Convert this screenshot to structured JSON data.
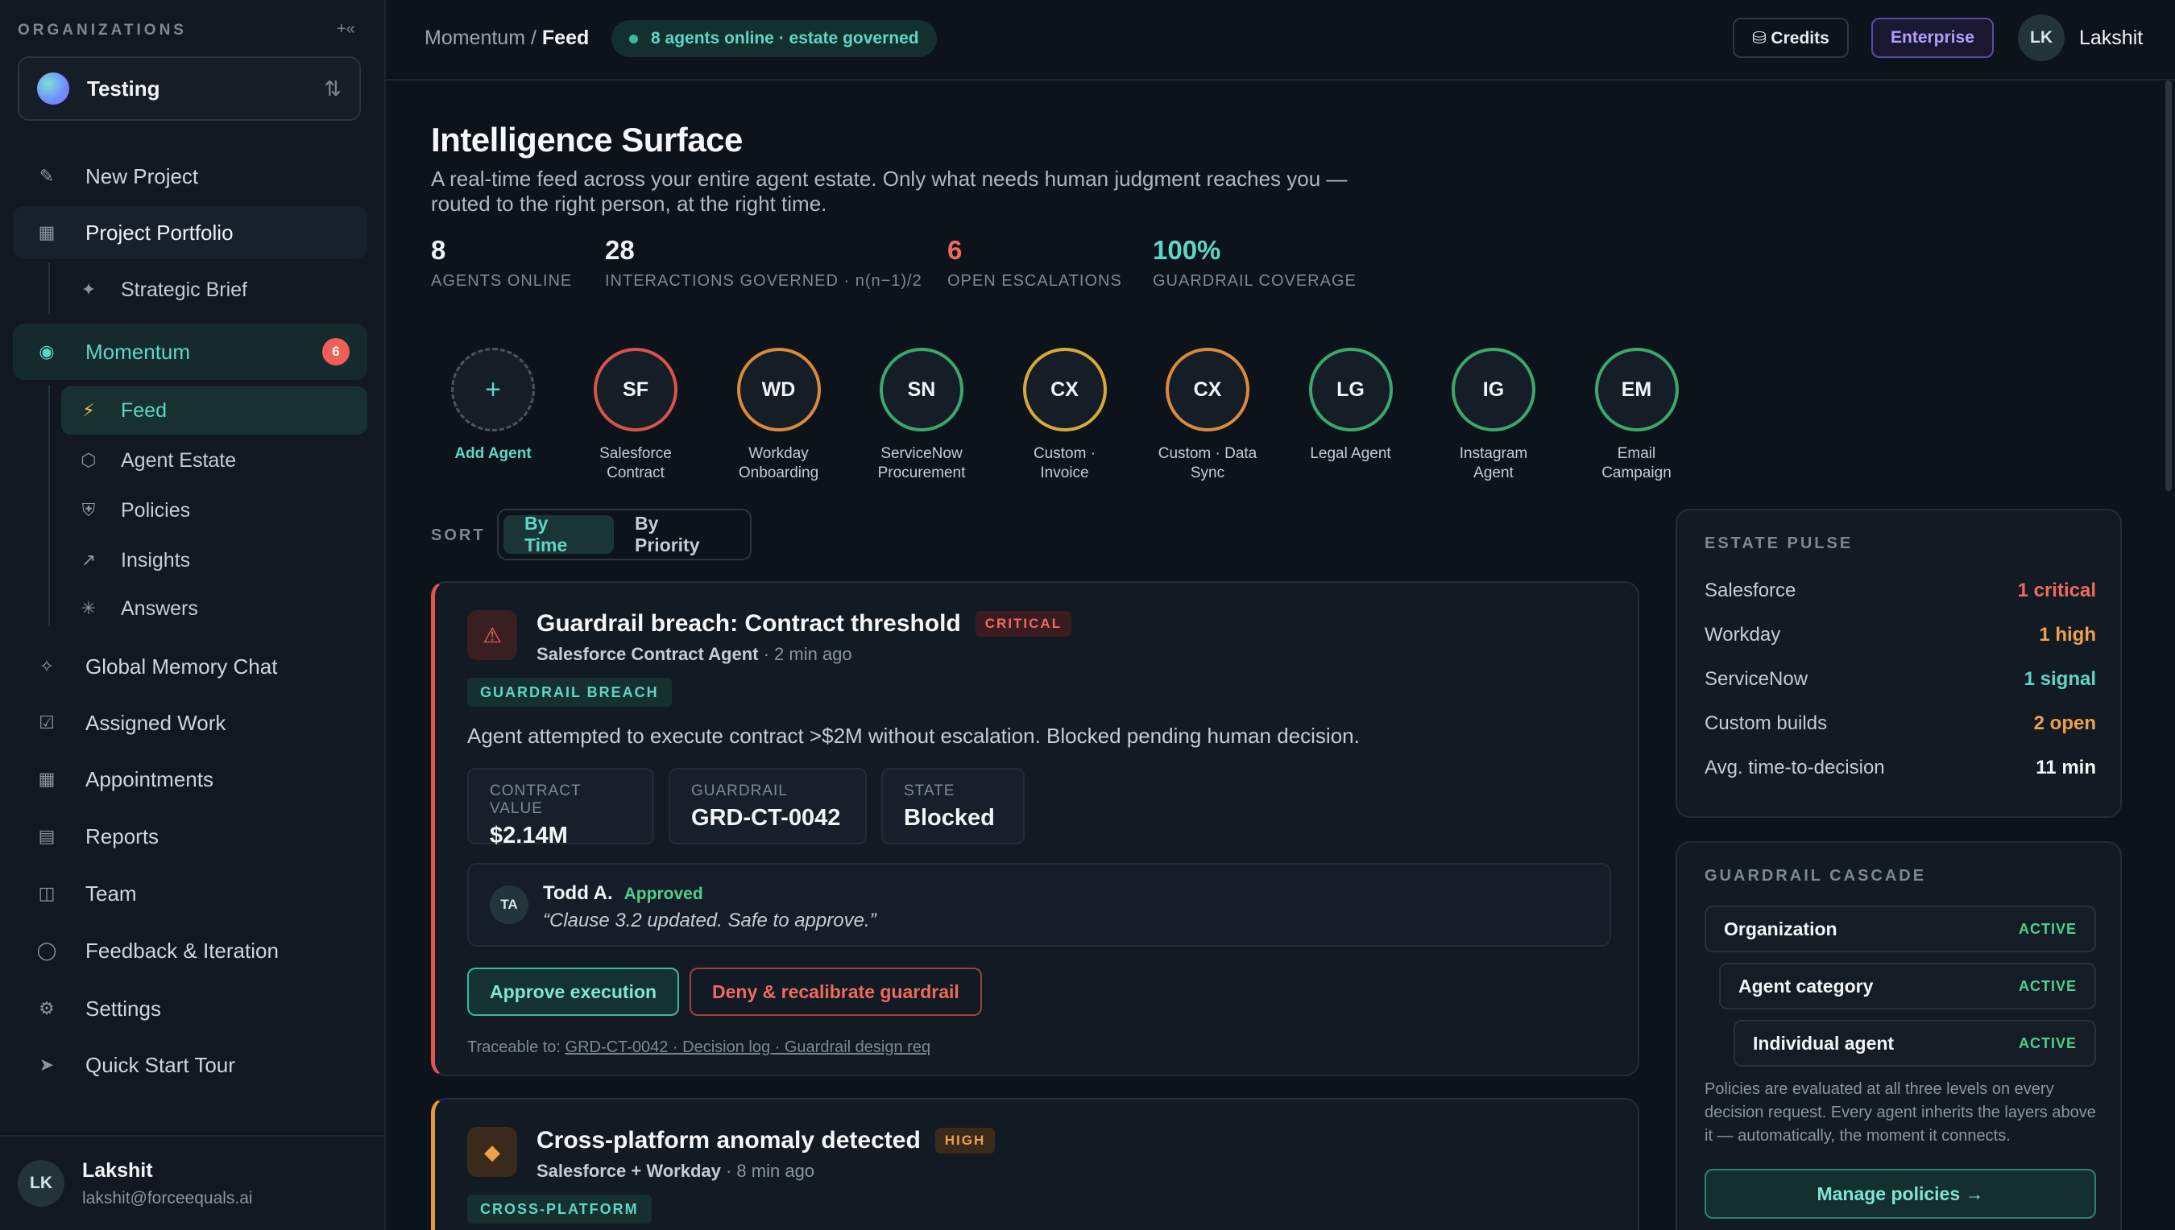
{
  "sidebar": {
    "org_label": "ORGANIZATIONS",
    "collapse_label": "+«",
    "org_name": "Testing",
    "org_switch_icon": "⇅",
    "items": [
      {
        "label": "New Project",
        "icon": "✎"
      },
      {
        "label": "Project Portfolio",
        "icon": "▦"
      },
      {
        "label": "Strategic Brief",
        "icon": "✦"
      },
      {
        "label": "Momentum",
        "icon": "◉",
        "badge": "6"
      },
      {
        "label": "Feed",
        "icon": "⚡"
      },
      {
        "label": "Agent Estate",
        "icon": "⬡"
      },
      {
        "label": "Policies",
        "icon": "⛨"
      },
      {
        "label": "Insights",
        "icon": "↗"
      },
      {
        "label": "Answers",
        "icon": "✳"
      },
      {
        "label": "Global Memory Chat",
        "icon": "✧"
      },
      {
        "label": "Assigned Work",
        "icon": "☑"
      },
      {
        "label": "Appointments",
        "icon": "▦"
      },
      {
        "label": "Reports",
        "icon": "▤"
      },
      {
        "label": "Team",
        "icon": "◫"
      },
      {
        "label": "Feedback & Iteration",
        "icon": "◯"
      },
      {
        "label": "Settings",
        "icon": "⚙"
      },
      {
        "label": "Quick Start Tour",
        "icon": "➤"
      }
    ],
    "user": {
      "initials": "LK",
      "name": "Lakshit",
      "email": "lakshit@forceequals.ai"
    }
  },
  "topbar": {
    "breadcrumb_parent": "Momentum",
    "breadcrumb_sep": " / ",
    "breadcrumb_current": "Feed",
    "status_text": "8  agents online · estate governed",
    "credits_label": "⛁ Credits",
    "enterprise_label": "Enterprise",
    "user_initials": "LK",
    "user_name": "Lakshit"
  },
  "header": {
    "title": "Intelligence Surface",
    "subtitle": "A real-time feed across your entire agent estate. Only what needs human judgment reaches you — routed to the right person, at the right time."
  },
  "stats": [
    {
      "value": "8",
      "caption": "AGENTS ONLINE"
    },
    {
      "value": "28",
      "caption": "INTERACTIONS GOVERNED · n(n−1)/2"
    },
    {
      "value": "6",
      "caption": "OPEN ESCALATIONS"
    },
    {
      "value": "100%",
      "caption": "GUARDRAIL COVERAGE"
    }
  ],
  "agents": {
    "add_label": "Add Agent",
    "add_icon": "+",
    "list": [
      {
        "initials": "SF",
        "name": "Salesforce Contract",
        "ring": "#d9534b",
        "dot": "#ef5f56"
      },
      {
        "initials": "WD",
        "name": "Workday Onboarding",
        "ring": "#d98a3a",
        "dot": "#f0a04a"
      },
      {
        "initials": "SN",
        "name": "ServiceNow Procurement",
        "ring": "#3aa86b",
        "dot": ""
      },
      {
        "initials": "CX",
        "name": "Custom · Invoice",
        "ring": "#d9a83a",
        "dot": "#f0c04a"
      },
      {
        "initials": "CX",
        "name": "Custom · Data Sync",
        "ring": "#d98a3a",
        "dot": "#f0a04a"
      },
      {
        "initials": "LG",
        "name": "Legal Agent",
        "ring": "#3aa86b",
        "dot": ""
      },
      {
        "initials": "IG",
        "name": "Instagram Agent",
        "ring": "#3aa86b",
        "dot": ""
      },
      {
        "initials": "EM",
        "name": "Email Campaign",
        "ring": "#3aa86b",
        "dot": ""
      }
    ]
  },
  "sort": {
    "label": "SORT",
    "options": [
      "By Time",
      "By Priority"
    ],
    "selected": "By Time"
  },
  "feed": [
    {
      "icon": "⚠",
      "title": "Guardrail breach: Contract threshold",
      "severity": "CRITICAL",
      "source": "Salesforce Contract Agent",
      "time": " · 2 min ago",
      "tag": "GUARDRAIL BREACH",
      "description": "Agent attempted to execute contract >$2M without escalation. Blocked pending human decision.",
      "metrics": [
        {
          "label": "CONTRACT VALUE",
          "value": "$2.14M"
        },
        {
          "label": "GUARDRAIL",
          "value": "GRD-CT-0042"
        },
        {
          "label": "STATE",
          "value": "Blocked"
        }
      ],
      "approval": {
        "initials": "TA",
        "name": "Todd A.",
        "status": "Approved",
        "quote": "“Clause 3.2 updated. Safe to approve.”"
      },
      "approve_label": "Approve execution",
      "deny_label": "Deny & recalibrate guardrail",
      "trace_prefix": "Traceable to: ",
      "trace_links": "GRD-CT-0042 · Decision log · Guardrail design req"
    },
    {
      "icon": "◆",
      "title": "Cross-platform anomaly detected",
      "severity": "HIGH",
      "source": "Salesforce + Workday",
      "time": " · 8 min ago",
      "tag": "CROSS-PLATFORM"
    }
  ],
  "pulse": {
    "title": "ESTATE PULSE",
    "rows": [
      {
        "label": "Salesforce",
        "value": "1 critical"
      },
      {
        "label": "Workday",
        "value": "1 high"
      },
      {
        "label": "ServiceNow",
        "value": "1 signal"
      },
      {
        "label": "Custom builds",
        "value": "2 open"
      },
      {
        "label": "Avg. time-to-decision",
        "value": "11 min"
      }
    ]
  },
  "cascade": {
    "title": "GUARDRAIL CASCADE",
    "layers": [
      {
        "name": "Organization",
        "status": "ACTIVE"
      },
      {
        "name": "Agent category",
        "status": "ACTIVE"
      },
      {
        "name": "Individual agent",
        "status": "ACTIVE"
      }
    ],
    "note": "Policies are evaluated at all three levels on every decision request. Every agent inherits the layers above it — automatically, the moment it connects.",
    "manage_label": "Manage policies →"
  }
}
